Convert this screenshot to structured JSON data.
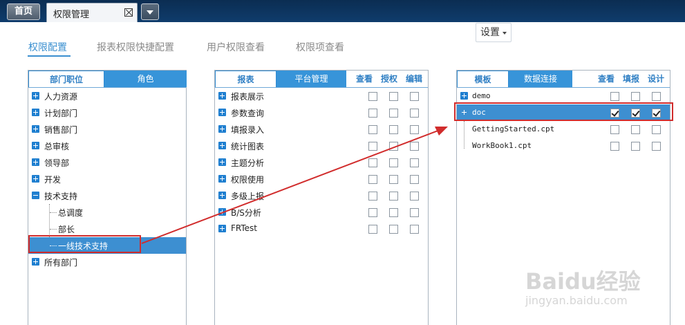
{
  "topbar": {
    "home_label": "首页",
    "tab_label": "权限管理"
  },
  "settings": {
    "label": "设置"
  },
  "page_tabs": [
    "权限配置",
    "报表权限快捷配置",
    "用户权限查看",
    "权限项查看"
  ],
  "dept_panel": {
    "tabs": [
      "部门职位",
      "角色"
    ],
    "items": [
      "人力资源",
      "计划部门",
      "销售部门",
      "总审核",
      "领导部",
      "开发",
      "技术支持",
      "总调度",
      "部长",
      "一线技术支持",
      "所有部门"
    ]
  },
  "report_panel": {
    "tabs": [
      "报表",
      "平台管理"
    ],
    "columns": [
      "查看",
      "授权",
      "编辑"
    ],
    "items": [
      "报表展示",
      "参数查询",
      "填报录入",
      "统计图表",
      "主题分析",
      "权限使用",
      "多级上报",
      "B/S分析",
      "FRTest"
    ]
  },
  "template_panel": {
    "tabs": [
      "模板",
      "数据连接"
    ],
    "columns": [
      "查看",
      "填报",
      "设计"
    ],
    "items": [
      "demo",
      "doc",
      "GettingStarted.cpt",
      "WorkBook1.cpt"
    ]
  },
  "colors": {
    "accent": "#3a8fd0",
    "selection": "#3d8fd1",
    "highlight": "#d12c2c",
    "topbar": "#0f3c6c"
  },
  "watermark": {
    "logo": "Baidu经验",
    "url": "jingyan.baidu.com"
  }
}
